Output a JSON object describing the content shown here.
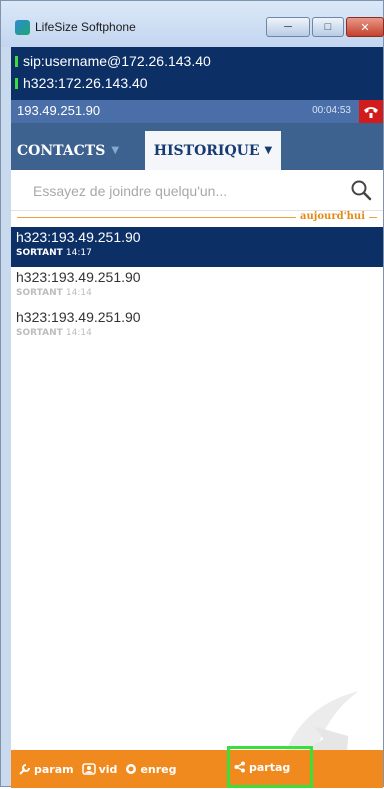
{
  "window": {
    "title": "LifeSize Softphone"
  },
  "accounts": [
    "sip:username@172.26.143.40",
    "h323:172.26.143.40"
  ],
  "call": {
    "address": "193.49.251.90",
    "timer": "00:04:53"
  },
  "tabs": {
    "contacts": "CONTACTS",
    "historique": "HISTORIQUE"
  },
  "search": {
    "placeholder": "Essayez de joindre quelqu'un..."
  },
  "day_separator": "aujourd'hui",
  "history": [
    {
      "address": "h323:193.49.251.90",
      "direction": "SORTANT",
      "time": "14:17"
    },
    {
      "address": "h323:193.49.251.90",
      "direction": "SORTANT",
      "time": "14:14"
    },
    {
      "address": "h323:193.49.251.90",
      "direction": "SORTANT",
      "time": "14:14"
    }
  ],
  "bottom_bar": {
    "param": "param",
    "vid": "vid",
    "enreg": "enreg",
    "partag": "partag"
  },
  "colors": {
    "navy": "#0c2f66",
    "orange": "#f08a1e",
    "hangup_red": "#d21c1c",
    "highlight_green": "#3cde3c"
  }
}
